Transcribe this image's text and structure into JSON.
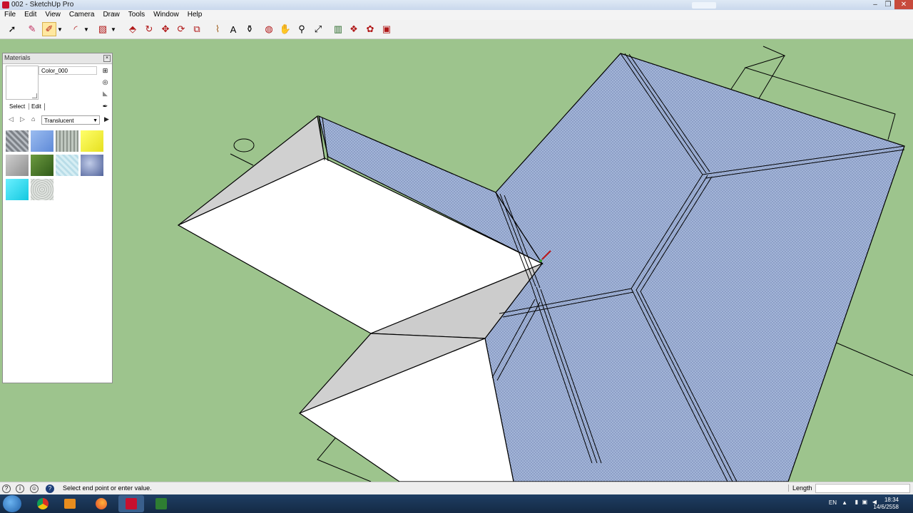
{
  "window": {
    "title": "002 - SketchUp Pro"
  },
  "menu": [
    "File",
    "Edit",
    "View",
    "Camera",
    "Draw",
    "Tools",
    "Window",
    "Help"
  ],
  "toolbar": {
    "tools": [
      "select-tool",
      "eraser-tool",
      "line-tool",
      "line-dropdown",
      "arc-tool",
      "arc-dropdown",
      "rectangle-tool",
      "rectangle-dropdown",
      "push-pull-tool",
      "follow-me-tool",
      "move-tool",
      "rotate-tool",
      "scale-tool",
      "tape-measure-tool",
      "text-tool",
      "paint-bucket-tool",
      "orbit-tool",
      "pan-tool",
      "zoom-tool",
      "zoom-extents-tool",
      "warehouse-tool",
      "components-tool",
      "extension-tool",
      "layout-tool"
    ],
    "active_tool": "line-tool"
  },
  "materials_panel": {
    "title": "Materials",
    "material_name": "Color_000",
    "tabs": [
      "Select",
      "Edit"
    ],
    "collection": "Translucent",
    "swatches": [
      {
        "name": "translucent-glass-grid",
        "color": "#9aa0a6"
      },
      {
        "name": "translucent-blue",
        "color": "#7fa7e6"
      },
      {
        "name": "translucent-striped",
        "color": "#a8b0a8"
      },
      {
        "name": "translucent-yellow",
        "color": "#f2f23a"
      },
      {
        "name": "translucent-gray",
        "color": "#b0b0b0"
      },
      {
        "name": "translucent-green",
        "color": "#4a7a2e"
      },
      {
        "name": "translucent-pale-cyan",
        "color": "#cde8f0"
      },
      {
        "name": "translucent-sky",
        "color": "#6c7fb5"
      },
      {
        "name": "translucent-cyan",
        "color": "#27e0f0"
      },
      {
        "name": "translucent-speckled",
        "color": "#cfd3cf"
      }
    ]
  },
  "status": {
    "message": "Select end point or enter value.",
    "vcb_label": "Length",
    "vcb_value": ""
  },
  "taskbar": {
    "language": "EN",
    "time": "18:34",
    "date": "14/6/2558"
  },
  "colors": {
    "ground": "#9dc48d",
    "translucent_face": "#9eb0d4",
    "white_face": "#ffffff",
    "gray_face": "#cfcfcf"
  }
}
